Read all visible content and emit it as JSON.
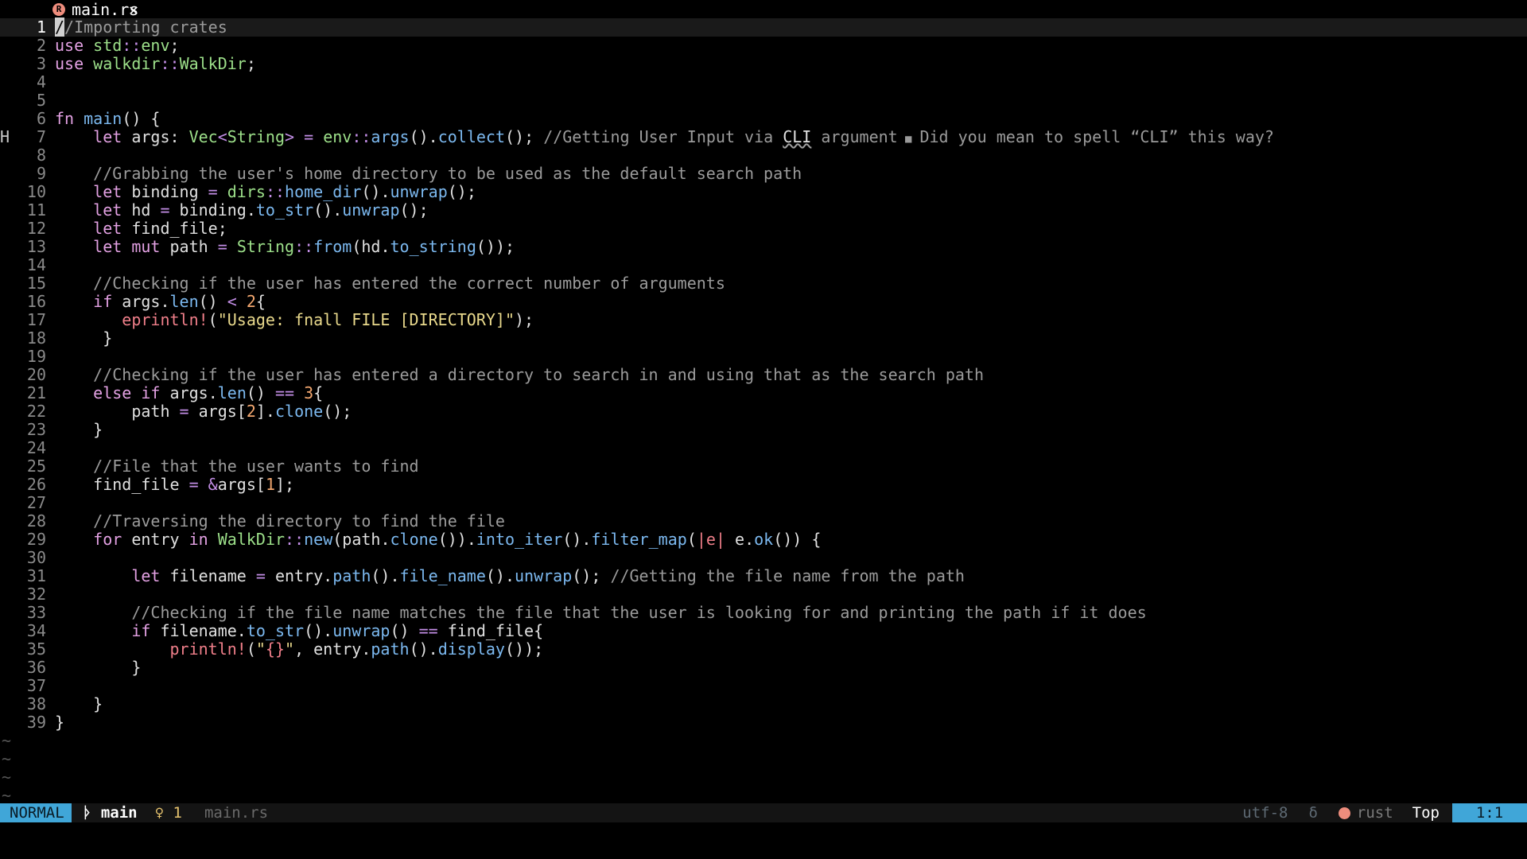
{
  "tab": {
    "filename": "main.rs",
    "close": "✕",
    "icon": "rust-icon"
  },
  "lines": [
    {
      "n": "1",
      "current": true,
      "sign": "",
      "tokens": [
        [
          "cursor",
          "/"
        ],
        [
          "cm",
          "/Importing crates"
        ]
      ]
    },
    {
      "n": "2",
      "tokens": [
        [
          "kw",
          "use"
        ],
        [
          "pl",
          " "
        ],
        [
          "ty",
          "std"
        ],
        [
          "op",
          "::"
        ],
        [
          "ty",
          "env"
        ],
        [
          "pl",
          ";"
        ]
      ]
    },
    {
      "n": "3",
      "tokens": [
        [
          "kw",
          "use"
        ],
        [
          "pl",
          " "
        ],
        [
          "ty",
          "walkdir"
        ],
        [
          "op",
          "::"
        ],
        [
          "ty",
          "WalkDir"
        ],
        [
          "pl",
          ";"
        ]
      ]
    },
    {
      "n": "4",
      "tokens": []
    },
    {
      "n": "5",
      "tokens": []
    },
    {
      "n": "6",
      "tokens": [
        [
          "kw",
          "fn"
        ],
        [
          "pl",
          " "
        ],
        [
          "fn",
          "main"
        ],
        [
          "pl",
          "() {"
        ]
      ]
    },
    {
      "n": "7",
      "sign": "H",
      "tokens": [
        [
          "pl",
          "    "
        ],
        [
          "kw",
          "let"
        ],
        [
          "pl",
          " args: "
        ],
        [
          "ty",
          "Vec"
        ],
        [
          "op",
          "<"
        ],
        [
          "ty",
          "String"
        ],
        [
          "op",
          ">"
        ],
        [
          "pl",
          " "
        ],
        [
          "op",
          "="
        ],
        [
          "pl",
          " "
        ],
        [
          "ty",
          "env"
        ],
        [
          "op",
          "::"
        ],
        [
          "fn",
          "args"
        ],
        [
          "pl",
          "()."
        ],
        [
          "fn",
          "collect"
        ],
        [
          "pl",
          "(); "
        ],
        [
          "cm",
          "//Getting User Input via "
        ],
        [
          "spell",
          "CLI"
        ],
        [
          "cm",
          " argument"
        ]
      ],
      "diag": "Did you mean to spell “CLI” this way?"
    },
    {
      "n": "8",
      "tokens": []
    },
    {
      "n": "9",
      "tokens": [
        [
          "pl",
          "    "
        ],
        [
          "cm",
          "//Grabbing the user's home directory to be used as the default search path"
        ]
      ]
    },
    {
      "n": "10",
      "tokens": [
        [
          "pl",
          "    "
        ],
        [
          "kw",
          "let"
        ],
        [
          "pl",
          " binding "
        ],
        [
          "op",
          "="
        ],
        [
          "pl",
          " "
        ],
        [
          "ty",
          "dirs"
        ],
        [
          "op",
          "::"
        ],
        [
          "fn",
          "home_dir"
        ],
        [
          "pl",
          "()."
        ],
        [
          "fn",
          "unwrap"
        ],
        [
          "pl",
          "();"
        ]
      ]
    },
    {
      "n": "11",
      "tokens": [
        [
          "pl",
          "    "
        ],
        [
          "kw",
          "let"
        ],
        [
          "pl",
          " hd "
        ],
        [
          "op",
          "="
        ],
        [
          "pl",
          " binding."
        ],
        [
          "fn",
          "to_str"
        ],
        [
          "pl",
          "()."
        ],
        [
          "fn",
          "unwrap"
        ],
        [
          "pl",
          "();"
        ]
      ]
    },
    {
      "n": "12",
      "tokens": [
        [
          "pl",
          "    "
        ],
        [
          "kw",
          "let"
        ],
        [
          "pl",
          " find_file;"
        ]
      ]
    },
    {
      "n": "13",
      "tokens": [
        [
          "pl",
          "    "
        ],
        [
          "kw",
          "let"
        ],
        [
          "pl",
          " "
        ],
        [
          "kw",
          "mut"
        ],
        [
          "pl",
          " path "
        ],
        [
          "op",
          "="
        ],
        [
          "pl",
          " "
        ],
        [
          "ty",
          "String"
        ],
        [
          "op",
          "::"
        ],
        [
          "fn",
          "from"
        ],
        [
          "pl",
          "(hd."
        ],
        [
          "fn",
          "to_string"
        ],
        [
          "pl",
          "());"
        ]
      ]
    },
    {
      "n": "14",
      "tokens": []
    },
    {
      "n": "15",
      "tokens": [
        [
          "pl",
          "    "
        ],
        [
          "cm",
          "//Checking if the user has entered the correct number of arguments"
        ]
      ]
    },
    {
      "n": "16",
      "tokens": [
        [
          "pl",
          "    "
        ],
        [
          "kw",
          "if"
        ],
        [
          "pl",
          " args."
        ],
        [
          "fn",
          "len"
        ],
        [
          "pl",
          "() "
        ],
        [
          "op",
          "<"
        ],
        [
          "pl",
          " "
        ],
        [
          "num",
          "2"
        ],
        [
          "pl",
          "{"
        ]
      ]
    },
    {
      "n": "17",
      "tokens": [
        [
          "pl",
          "       "
        ],
        [
          "mac",
          "eprintln!"
        ],
        [
          "pl",
          "("
        ],
        [
          "str",
          "\"Usage: fnall FILE [DIRECTORY]\""
        ],
        [
          "pl",
          ");"
        ]
      ]
    },
    {
      "n": "18",
      "tokens": [
        [
          "pl",
          "     }"
        ]
      ]
    },
    {
      "n": "19",
      "tokens": []
    },
    {
      "n": "20",
      "tokens": [
        [
          "pl",
          "    "
        ],
        [
          "cm",
          "//Checking if the user has entered a directory to search in and using that as the search path"
        ]
      ]
    },
    {
      "n": "21",
      "tokens": [
        [
          "pl",
          "    "
        ],
        [
          "kw",
          "else"
        ],
        [
          "pl",
          " "
        ],
        [
          "kw",
          "if"
        ],
        [
          "pl",
          " args."
        ],
        [
          "fn",
          "len"
        ],
        [
          "pl",
          "() "
        ],
        [
          "op",
          "=="
        ],
        [
          "pl",
          " "
        ],
        [
          "num",
          "3"
        ],
        [
          "pl",
          "{"
        ]
      ]
    },
    {
      "n": "22",
      "tokens": [
        [
          "pl",
          "        path "
        ],
        [
          "op",
          "="
        ],
        [
          "pl",
          " args["
        ],
        [
          "num",
          "2"
        ],
        [
          "pl",
          "]."
        ],
        [
          "fn",
          "clone"
        ],
        [
          "pl",
          "();"
        ]
      ]
    },
    {
      "n": "23",
      "tokens": [
        [
          "pl",
          "    }"
        ]
      ]
    },
    {
      "n": "24",
      "tokens": []
    },
    {
      "n": "25",
      "tokens": [
        [
          "pl",
          "    "
        ],
        [
          "cm",
          "//File that the user wants to find"
        ]
      ]
    },
    {
      "n": "26",
      "tokens": [
        [
          "pl",
          "    find_file "
        ],
        [
          "op",
          "="
        ],
        [
          "pl",
          " "
        ],
        [
          "op",
          "&"
        ],
        [
          "pl",
          "args["
        ],
        [
          "num",
          "1"
        ],
        [
          "pl",
          "];"
        ]
      ]
    },
    {
      "n": "27",
      "tokens": []
    },
    {
      "n": "28",
      "tokens": [
        [
          "pl",
          "    "
        ],
        [
          "cm",
          "//Traversing the directory to find the file"
        ]
      ]
    },
    {
      "n": "29",
      "tokens": [
        [
          "pl",
          "    "
        ],
        [
          "kw",
          "for"
        ],
        [
          "pl",
          " entry "
        ],
        [
          "kw",
          "in"
        ],
        [
          "pl",
          " "
        ],
        [
          "ty",
          "WalkDir"
        ],
        [
          "op",
          "::"
        ],
        [
          "fn",
          "new"
        ],
        [
          "pl",
          "(path."
        ],
        [
          "fn",
          "clone"
        ],
        [
          "pl",
          "())."
        ],
        [
          "fn",
          "into_iter"
        ],
        [
          "pl",
          "()."
        ],
        [
          "fn",
          "filter_map"
        ],
        [
          "pl",
          "("
        ],
        [
          "mac",
          "|e|"
        ],
        [
          "pl",
          " e."
        ],
        [
          "fn",
          "ok"
        ],
        [
          "pl",
          "()) {"
        ]
      ]
    },
    {
      "n": "30",
      "tokens": []
    },
    {
      "n": "31",
      "tokens": [
        [
          "pl",
          "        "
        ],
        [
          "kw",
          "let"
        ],
        [
          "pl",
          " filename "
        ],
        [
          "op",
          "="
        ],
        [
          "pl",
          " entry."
        ],
        [
          "fn",
          "path"
        ],
        [
          "pl",
          "()."
        ],
        [
          "fn",
          "file_name"
        ],
        [
          "pl",
          "()."
        ],
        [
          "fn",
          "unwrap"
        ],
        [
          "pl",
          "(); "
        ],
        [
          "cm",
          "//Getting the file name from the path"
        ]
      ]
    },
    {
      "n": "32",
      "tokens": []
    },
    {
      "n": "33",
      "tokens": [
        [
          "pl",
          "        "
        ],
        [
          "cm",
          "//Checking if the file name matches the file that the user is looking for and printing the path if it does"
        ]
      ]
    },
    {
      "n": "34",
      "tokens": [
        [
          "pl",
          "        "
        ],
        [
          "kw",
          "if"
        ],
        [
          "pl",
          " filename."
        ],
        [
          "fn",
          "to_str"
        ],
        [
          "pl",
          "()."
        ],
        [
          "fn",
          "unwrap"
        ],
        [
          "pl",
          "() "
        ],
        [
          "op",
          "=="
        ],
        [
          "pl",
          " find_file{"
        ]
      ]
    },
    {
      "n": "35",
      "tokens": [
        [
          "pl",
          "            "
        ],
        [
          "mac",
          "println!"
        ],
        [
          "pl",
          "("
        ],
        [
          "str",
          "\""
        ],
        [
          "mac",
          "{}"
        ],
        [
          "str",
          "\""
        ],
        [
          "pl",
          ", entry."
        ],
        [
          "fn",
          "path"
        ],
        [
          "pl",
          "()."
        ],
        [
          "fn",
          "display"
        ],
        [
          "pl",
          "());"
        ]
      ]
    },
    {
      "n": "36",
      "tokens": [
        [
          "pl",
          "        }"
        ]
      ]
    },
    {
      "n": "37",
      "tokens": []
    },
    {
      "n": "38",
      "tokens": [
        [
          "pl",
          "    }"
        ]
      ]
    },
    {
      "n": "39",
      "tokens": [
        [
          "pl",
          "}"
        ]
      ]
    }
  ],
  "tildes": [
    "~",
    "~",
    "~",
    "~"
  ],
  "status": {
    "mode": "NORMAL",
    "branch_icon": "git-branch-icon",
    "branch": "main",
    "diag_icon": "lightbulb-icon",
    "diag_count": "1",
    "filename": "main.rs",
    "encoding": "utf-8",
    "format_icon": "delta-icon",
    "format_glyph": "δ",
    "language": "rust",
    "position": "Top",
    "cursor": "1:1"
  },
  "colors": {
    "accent": "#40a6d8",
    "keyword": "#e3a1e3",
    "function": "#7cb9f0",
    "type": "#9de08a",
    "macro": "#f07f8a",
    "string": "#e9d98c",
    "number": "#f3a76f",
    "comment": "#9b9b9b"
  }
}
